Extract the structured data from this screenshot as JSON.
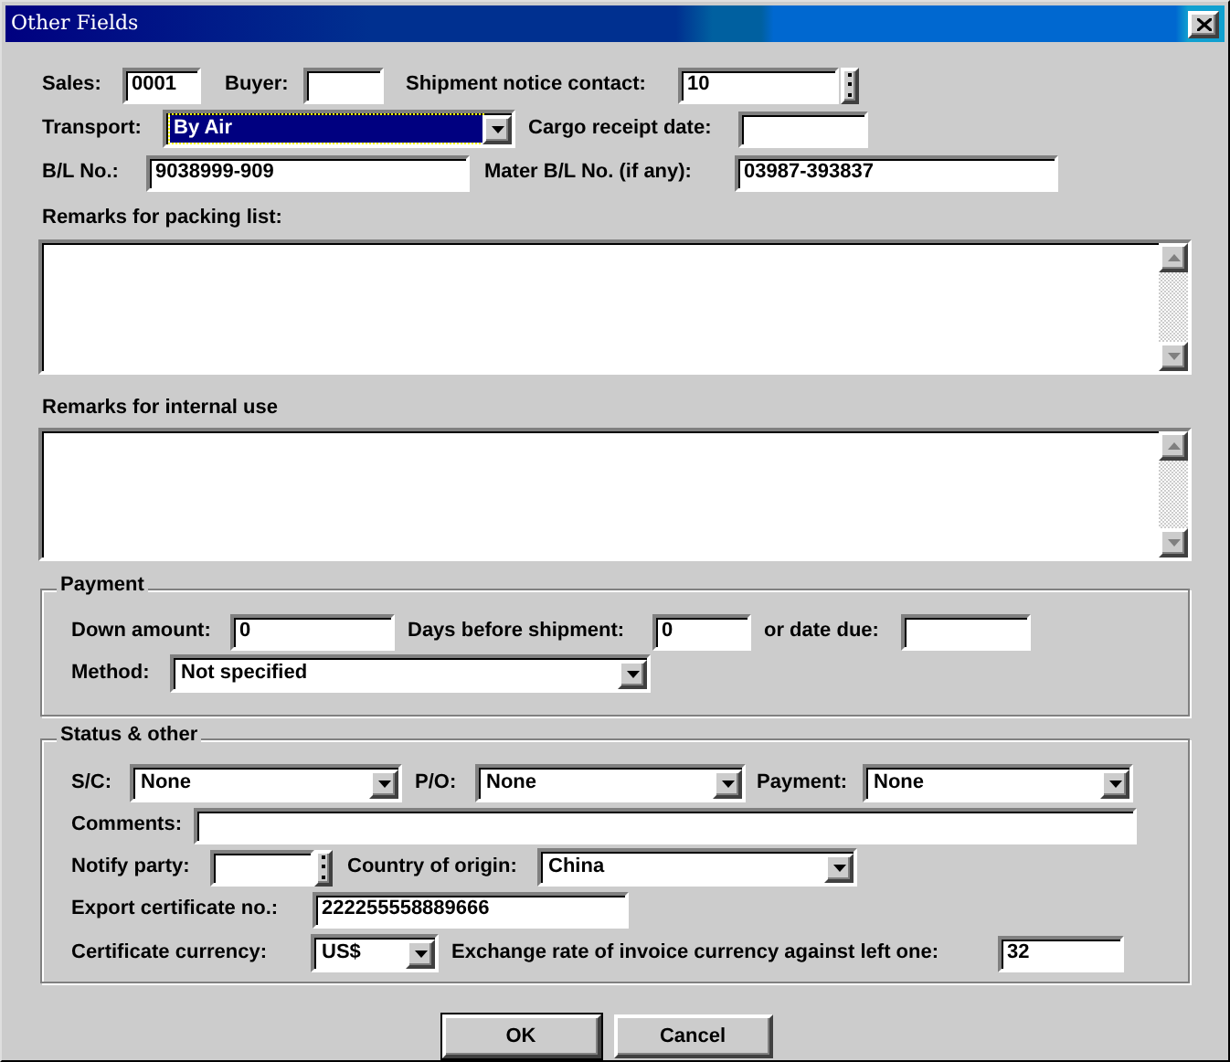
{
  "window": {
    "title": "Other Fields"
  },
  "sales": {
    "label": "Sales:",
    "value": "0001"
  },
  "buyer": {
    "label": "Buyer:"
  },
  "shipment_notice_contact": {
    "label": "Shipment notice contact:",
    "value": "10"
  },
  "transport": {
    "label": "Transport:",
    "value": "By Air",
    "highlighted": true
  },
  "cargo_receipt_date": {
    "label": "Cargo receipt date:"
  },
  "bl_no": {
    "label": "B/L No.:",
    "value": "9038999-909"
  },
  "mater_bl_no": {
    "label": "Mater B/L No. (if any):",
    "value": "03987-393837"
  },
  "remarks_packing": {
    "label": "Remarks for packing list:"
  },
  "remarks_internal": {
    "label": "Remarks for internal use"
  },
  "payment": {
    "title": "Payment",
    "down_amount": {
      "label": "Down amount:",
      "value": "0"
    },
    "days_before_shipment": {
      "label": "Days before shipment:",
      "value": "0"
    },
    "date_due": {
      "label": "or date due:"
    },
    "method": {
      "label": "Method:",
      "value": "Not specified"
    }
  },
  "status": {
    "title": "Status & other",
    "sc": {
      "label": "S/C:",
      "value": "None"
    },
    "po": {
      "label": "P/O:",
      "value": "None"
    },
    "payment": {
      "label": "Payment:",
      "value": "None"
    },
    "comments": {
      "label": "Comments:"
    },
    "notify_party": {
      "label": "Notify party:"
    },
    "country_of_origin": {
      "label": "Country of origin:",
      "value": "China"
    },
    "export_certificate_no": {
      "label": "Export certificate no.:",
      "value": "222255558889666"
    },
    "certificate_currency": {
      "label": "Certificate currency:",
      "value": "US$"
    },
    "exchange_rate": {
      "label": "Exchange rate of invoice currency against left one:",
      "value": "32"
    }
  },
  "buttons": [
    {
      "label": "OK",
      "default": true
    },
    {
      "label": "Cancel",
      "default": false
    }
  ]
}
